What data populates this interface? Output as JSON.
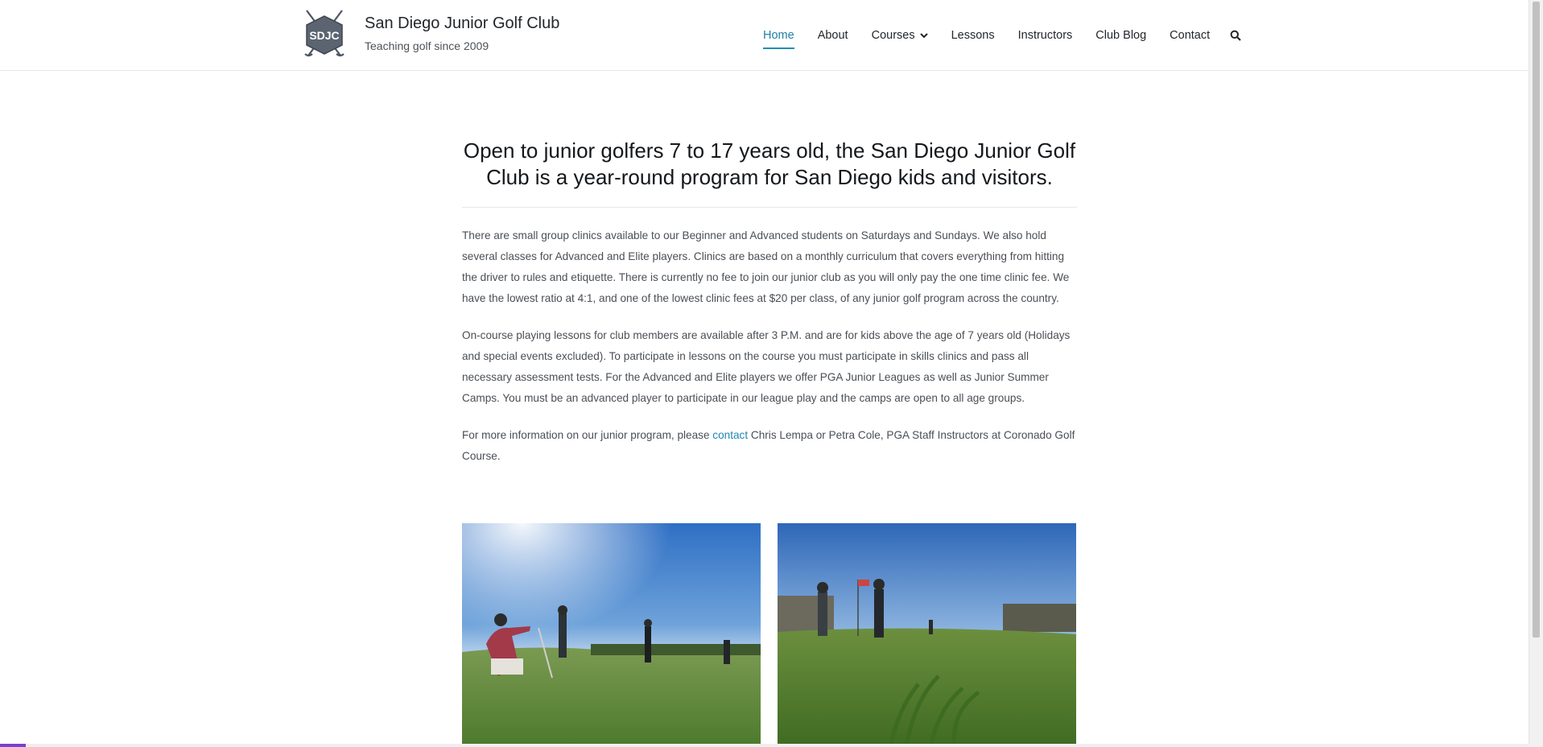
{
  "site": {
    "logo_text": "SDJC",
    "title": "San Diego Junior Golf Club",
    "tagline": "Teaching golf since 2009"
  },
  "nav": {
    "items": [
      "Home",
      "About",
      "Courses",
      "Lessons",
      "Instructors",
      "Club Blog",
      "Contact"
    ],
    "active": "Home",
    "search_icon": "search-icon",
    "accent_color": "#1f8fb5"
  },
  "main": {
    "headline": "Open to junior golfers 7 to 17 years old, the San Diego Junior Golf Club is a year-round program for San Diego kids and visitors.",
    "paragraph1": "There are small group clinics available to our Beginner and Advanced students on Saturdays and Sundays.  We also hold several classes for Advanced and Elite players.  Clinics are based on a monthly curriculum that covers everything from hitting the driver to rules and etiquette.  There is currently no fee to join our junior club as you will only pay the one time clinic fee.  We have the lowest ratio at 4:1, and one of the lowest clinic fees at $20 per class, of any junior golf program across the country.",
    "paragraph2": "On-course playing lessons for club members are available after 3 P.M. and are for kids above the age of 7 years old (Holidays and special events excluded).  To participate in lessons on the course you must participate in skills clinics and pass all necessary assessment tests.  For the Advanced and Elite players we offer PGA Junior Leagues as well as Junior Summer Camps.  You must be an advanced player to participate in our league play and the camps are open to all age groups.",
    "paragraph3_before": "For more information on our junior program, please ",
    "paragraph3_link": "contact",
    "paragraph3_after": " Chris Lempa or Petra Cole, PGA Staff Instructors at Coronado Golf Course."
  }
}
